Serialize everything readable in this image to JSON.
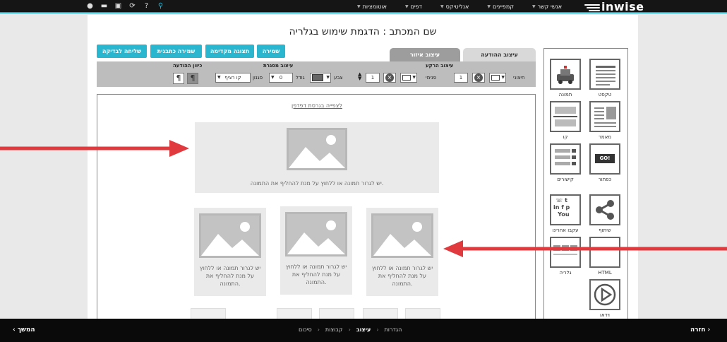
{
  "topbar": {
    "logo_text": "inwise",
    "nav": [
      {
        "label": "אנשי קשר"
      },
      {
        "label": "קמפיינים"
      },
      {
        "label": "אנליטיקס"
      },
      {
        "label": "דפים"
      },
      {
        "label": "אוטומציות"
      }
    ],
    "icons": [
      "user-icon",
      "message-icon",
      "help-icon",
      "image-icon",
      "info-icon",
      "search-icon"
    ]
  },
  "page": {
    "title": "שם המכתב : הדגמת שימוש בגלריה"
  },
  "tabs": {
    "message_design": "עיצוב ההודעה",
    "area_design": "עיצוב איזור"
  },
  "buttons": {
    "save": "שמירה",
    "preview": "תצוגה מקדימה",
    "save_template": "שמירה כתבנית",
    "send_test": "שליחה לבדיקה"
  },
  "toolbar": {
    "background_label": "עיצוב הרקע",
    "outer_label": "חיצוני",
    "inner_label": "פנימי",
    "outer_value": "1",
    "inner_value": "1",
    "border_label": "עיצוב מסגרת",
    "color_label": "צבע",
    "size_label": "גודל",
    "size_value": "0",
    "style_label": "סגנון",
    "style_value": "קו רציף",
    "direction_label": "כיוון ההודעה"
  },
  "canvas": {
    "browser_link": "לצפייה בגרסת דפדפן",
    "big_caption": "יש לגרור תמונה או ללחוץ על מנת להחליף את התמונה.",
    "small_captions": [
      "יש לגרור תמונה או ללחוץ על מנת להחליף את התמונה.",
      "יש לגרור תמונה או ללחוץ על מנת להחליף את התמונה.",
      "יש לגרור תמונה או ללחוץ על מנת להחליף את התמונה."
    ]
  },
  "widgets": [
    {
      "label": "טקסט",
      "icon": "text-icon"
    },
    {
      "label": "תמונה",
      "icon": "image-icon"
    },
    {
      "label": "מאמר",
      "icon": "article-icon"
    },
    {
      "label": "קו",
      "icon": "line-icon"
    },
    {
      "label": "כפתור",
      "icon": "button-icon",
      "inner_text": "GO!"
    },
    {
      "label": "קישורים",
      "icon": "links-icon"
    },
    {
      "label": "שיתוף",
      "icon": "share-icon"
    },
    {
      "label": "עקבו אחרינו",
      "icon": "follow-us-icon"
    },
    {
      "label": "HTML",
      "icon": "html-icon",
      "inner_text": "HTML"
    },
    {
      "label": "גלריה",
      "icon": "gallery-icon"
    },
    {
      "label": "וידאו",
      "icon": "video-icon"
    }
  ],
  "bottombar": {
    "next": "המשך",
    "back": "חזרה",
    "steps": [
      "הגדרות",
      "עיצוב",
      "קבוצות",
      "סיכום"
    ],
    "active_step": "עיצוב"
  },
  "colors": {
    "accent": "#2ab6cf",
    "arrow": "#e0393e",
    "topbar": "#151515"
  }
}
